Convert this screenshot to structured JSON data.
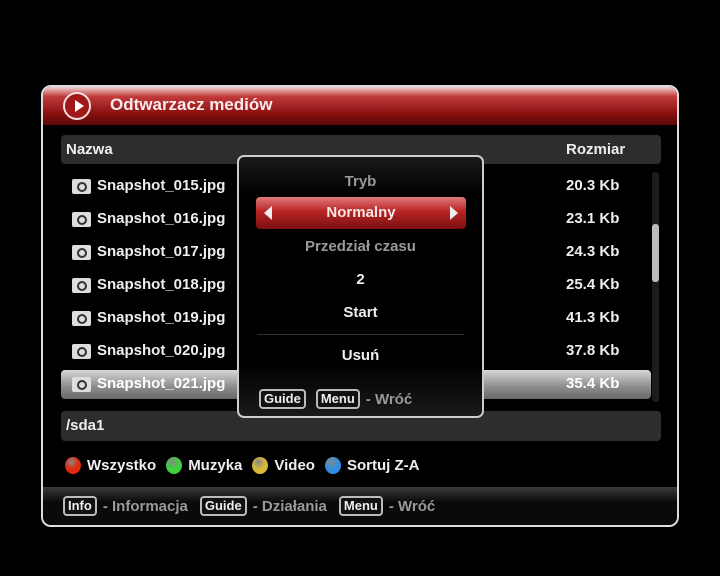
{
  "header": {
    "title": "Odtwarzacz mediów",
    "icon": "play-icon"
  },
  "columns": {
    "name": "Nazwa",
    "size": "Rozmiar"
  },
  "files": [
    {
      "name": "Snapshot_015.jpg",
      "size": "20.3 Kb"
    },
    {
      "name": "Snapshot_016.jpg",
      "size": "23.1 Kb"
    },
    {
      "name": "Snapshot_017.jpg",
      "size": "24.3 Kb"
    },
    {
      "name": "Snapshot_018.jpg",
      "size": "25.4 Kb"
    },
    {
      "name": "Snapshot_019.jpg",
      "size": "41.3 Kb"
    },
    {
      "name": "Snapshot_020.jpg",
      "size": "37.8 Kb"
    },
    {
      "name": "Snapshot_021.jpg",
      "size": "35.4 Kb"
    }
  ],
  "selected_index": 6,
  "path": "/sda1",
  "color_keys": [
    {
      "label": "Wszystko",
      "color": "#e02a10"
    },
    {
      "label": "Muzyka",
      "color": "#3ecf3e"
    },
    {
      "label": "Video",
      "color": "#d8b838"
    },
    {
      "label": "Sortuj Z-A",
      "color": "#2f8ee0"
    }
  ],
  "footer": [
    {
      "key": "Info",
      "label": "- Informacja"
    },
    {
      "key": "Guide",
      "label": "- Działania"
    },
    {
      "key": "Menu",
      "label": "- Wróć"
    }
  ],
  "popup": {
    "mode_label": "Tryb",
    "mode_value": "Normalny",
    "interval_label": "Przedział czasu",
    "interval_value": "2",
    "start": "Start",
    "delete": "Usuń",
    "guide_key": "Guide",
    "menu_key": "Menu",
    "back": "- Wróć"
  }
}
